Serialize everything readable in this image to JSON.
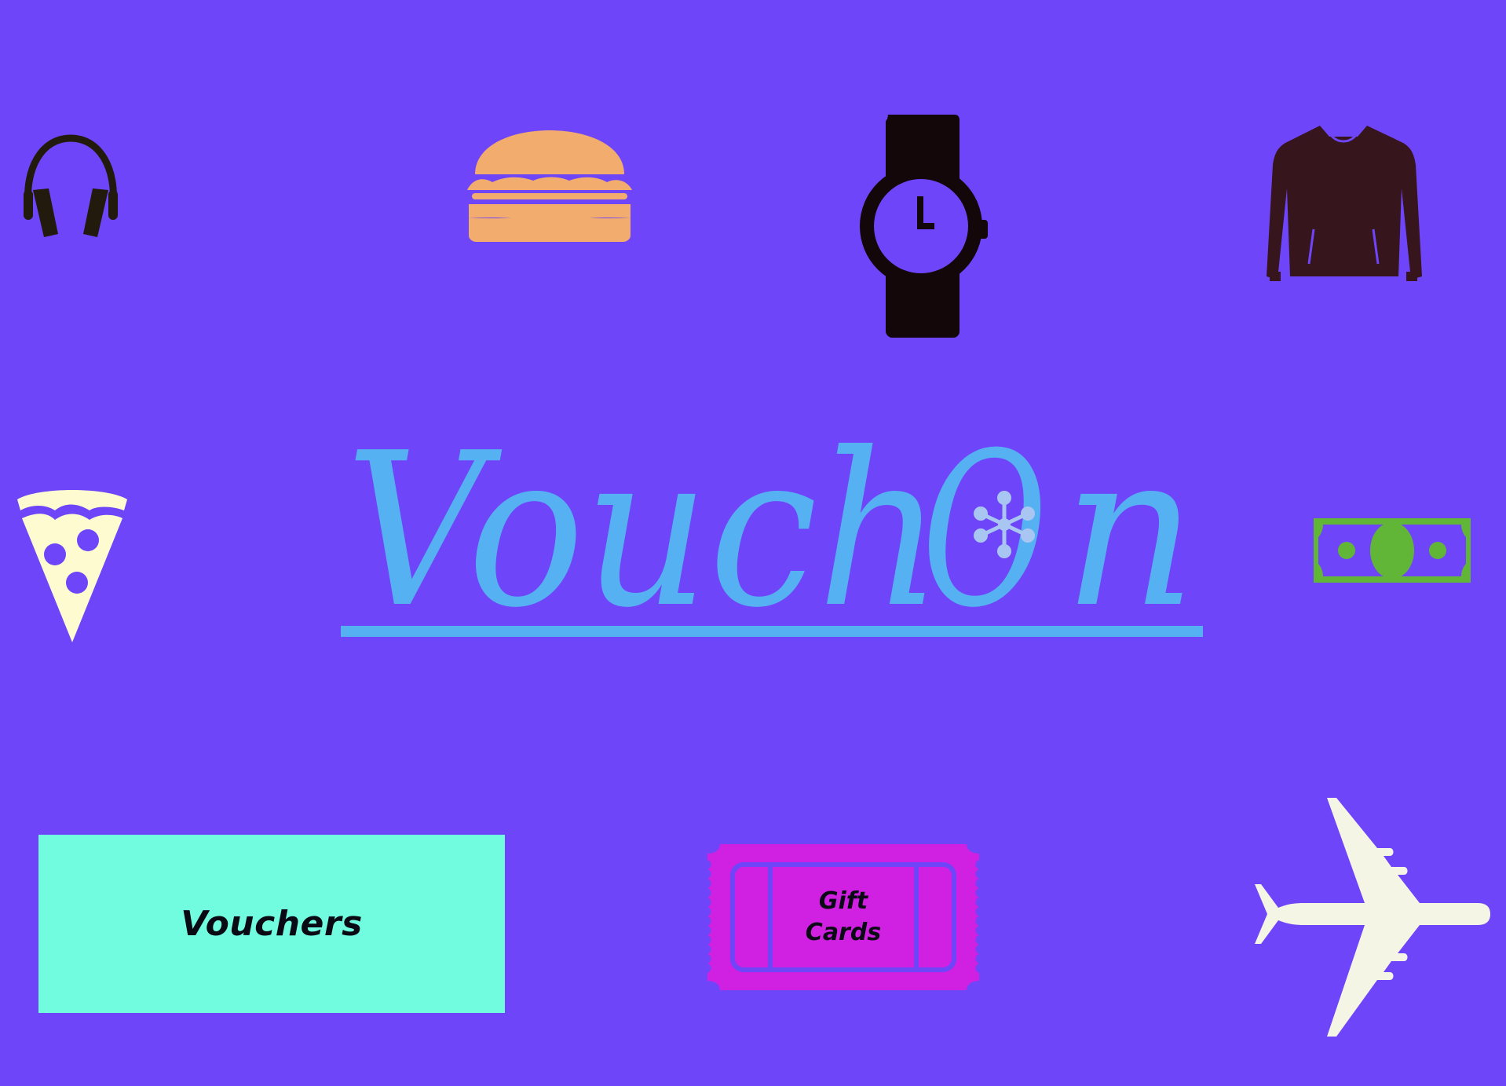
{
  "app": {
    "brand": "VouchOn"
  },
  "logo": {
    "text_before": "Vouch",
    "text_o": "O",
    "text_after": "n"
  },
  "buttons": {
    "vouchers_label": "Vouchers",
    "giftcards_label": "Gift\nCards"
  },
  "icons": [
    "headphones-icon",
    "burger-icon",
    "wristwatch-icon",
    "sweater-icon",
    "pizza-slice-icon",
    "banknote-icon",
    "airplane-icon",
    "ticket-icon"
  ],
  "colors": {
    "background": "#6f45f9",
    "logo": "#56b1f3",
    "vouchers_button": "#71fbdf",
    "giftcards_ticket": "#d020e2",
    "headphones": "#231a0e",
    "burger": "#f2ac6e",
    "watch": "#130709",
    "sweater": "#36151d",
    "pizza": "#fdfbcf",
    "banknote": "#62b637",
    "airplane": "#f5f5e6"
  }
}
